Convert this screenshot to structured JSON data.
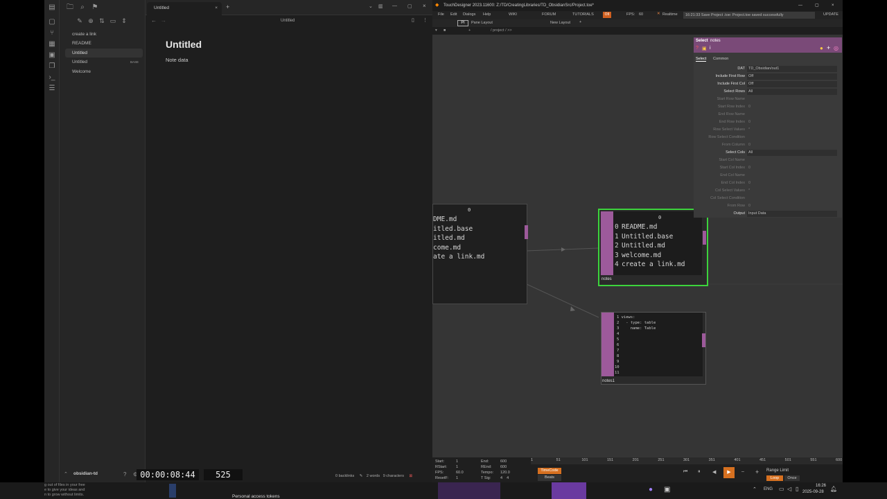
{
  "obsidian": {
    "tab_title": "Untitled",
    "header_title": "Untitled",
    "files": [
      {
        "label": "create a link",
        "badge": ""
      },
      {
        "label": "README",
        "badge": ""
      },
      {
        "label": "Untitled",
        "badge": ""
      },
      {
        "label": "Untitled",
        "badge": "BASE"
      },
      {
        "label": "Welcome",
        "badge": ""
      }
    ],
    "note_title": "Untitled",
    "note_body": "Note data",
    "vault_name": "obsidian-td",
    "status": {
      "backlinks": "0 backlinks",
      "words": "2 words",
      "chars": "9 characters"
    }
  },
  "touchdesigner": {
    "title": "TouchDesigner 2023.11600: Z:/TD/CreatingLibraries/TD_ObsidianSrc/Project.toe*",
    "menu": [
      "File",
      "Edit",
      "Dialogs",
      "Help"
    ],
    "menu_links": [
      "WIKI",
      "FORUM",
      "TUTORIALS"
    ],
    "fps_label": "FPS:",
    "fps_value": "60",
    "realtime": "Realtime",
    "save_message": "16:21:33 Save Project .toe: Project.toe saved successfully",
    "update": "UPDATE",
    "pane_layout": "Pane Layout",
    "new_layout": "New Layout",
    "path": "/ project / >>",
    "params": {
      "op_type": "Select",
      "op_name": "notes",
      "tabs": [
        "Select",
        "Common"
      ],
      "rows": [
        {
          "label": "DAT",
          "value": "TD_Obsidian/out1",
          "dim": false
        },
        {
          "label": "Include First Row",
          "value": "Off",
          "dim": false
        },
        {
          "label": "Include First Col",
          "value": "Off",
          "dim": false
        },
        {
          "label": "Select Rows",
          "value": "All",
          "dim": false
        },
        {
          "label": "Start Row Name",
          "value": "",
          "dim": true
        },
        {
          "label": "Start Row Index",
          "value": "0",
          "dim": true
        },
        {
          "label": "End Row Name",
          "value": "",
          "dim": true
        },
        {
          "label": "End Row Index",
          "value": "0",
          "dim": true
        },
        {
          "label": "Row Select Values",
          "value": "*",
          "dim": true
        },
        {
          "label": "Row Select Condition",
          "value": "",
          "dim": true
        },
        {
          "label": "From Column",
          "value": "0",
          "dim": true
        },
        {
          "label": "Select Cols",
          "value": "All",
          "dim": false
        },
        {
          "label": "Start Col Name",
          "value": "",
          "dim": true
        },
        {
          "label": "Start Col Index",
          "value": "0",
          "dim": true
        },
        {
          "label": "End Col Name",
          "value": "",
          "dim": true
        },
        {
          "label": "End Col Index",
          "value": "0",
          "dim": true
        },
        {
          "label": "Col Select Values",
          "value": "*",
          "dim": true
        },
        {
          "label": "Col Select Condition",
          "value": "",
          "dim": true
        },
        {
          "label": "From Row",
          "value": "0",
          "dim": true
        },
        {
          "label": "Output",
          "value": "Input Data",
          "dim": false
        }
      ]
    },
    "node_left": {
      "header": "0",
      "rows": [
        "DME.md",
        "itled.base",
        "itled.md",
        "come.md",
        "ate a link.md"
      ]
    },
    "node_notes": {
      "name": "notes",
      "header": "0",
      "rows": [
        {
          "idx": "0",
          "text": "README.md"
        },
        {
          "idx": "1",
          "text": "Untitled.base"
        },
        {
          "idx": "2",
          "text": "Untitled.md"
        },
        {
          "idx": "3",
          "text": "welcome.md"
        },
        {
          "idx": "4",
          "text": "create a link.md"
        }
      ]
    },
    "node_notes1": {
      "name": "notes1",
      "lines": [
        "1 views:",
        "2   - type: table",
        "3     name: Table",
        "4",
        "5",
        "6",
        "7",
        "8",
        "9",
        "10",
        "11"
      ]
    },
    "timeline": {
      "start": "1",
      "end": "600",
      "rstart": "1",
      "rend": "600",
      "fps": "60.0",
      "tempo": "120.0",
      "resetf": "1",
      "tsig": "4    4",
      "timecode_label": "TimeCode",
      "beats_label": "Beats",
      "timecode": "00:00:08:44",
      "frame": "525",
      "range_limit": "Range Limit",
      "loop": "Loop",
      "once": "Once",
      "ticks": [
        "1",
        "51",
        "101",
        "151",
        "201",
        "251",
        "301",
        "351",
        "401",
        "451",
        "501",
        "551",
        "600"
      ]
    }
  },
  "taskbar": {
    "left_text": [
      "g out of files in your free",
      "e to give your ideas and",
      "n to grow without limits."
    ],
    "middle_text": "Personal access tokens",
    "lang": "ENG",
    "time": "16:26",
    "date": "2025-09-28"
  }
}
